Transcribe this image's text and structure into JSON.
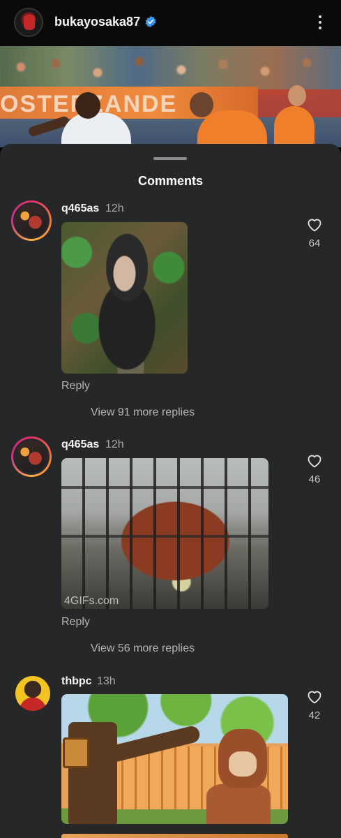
{
  "header": {
    "username": "bukayosaka87",
    "verified_icon": "verified-badge-icon",
    "more_icon": "more-vertical-icon"
  },
  "hero": {
    "banner_text": "OSTERZANDE"
  },
  "sheet": {
    "title": "Comments"
  },
  "comments": [
    {
      "user": "q465as",
      "time": "12h",
      "likes": "64",
      "reply_label": "Reply",
      "view_replies": "View 91 more replies",
      "media": "chimpanzee-gif"
    },
    {
      "user": "q465as",
      "time": "12h",
      "likes": "46",
      "reply_label": "Reply",
      "view_replies": "View 56 more replies",
      "media": "orangutan-gif",
      "media_watermark": "4GIFs.com"
    },
    {
      "user": "thbpc",
      "time": "13h",
      "likes": "42",
      "media": "cartoon-monkey-gif"
    }
  ],
  "colors": {
    "sheet_bg": "#262729",
    "top_bg": "#0a0a0a",
    "verified": "#3897f0"
  }
}
